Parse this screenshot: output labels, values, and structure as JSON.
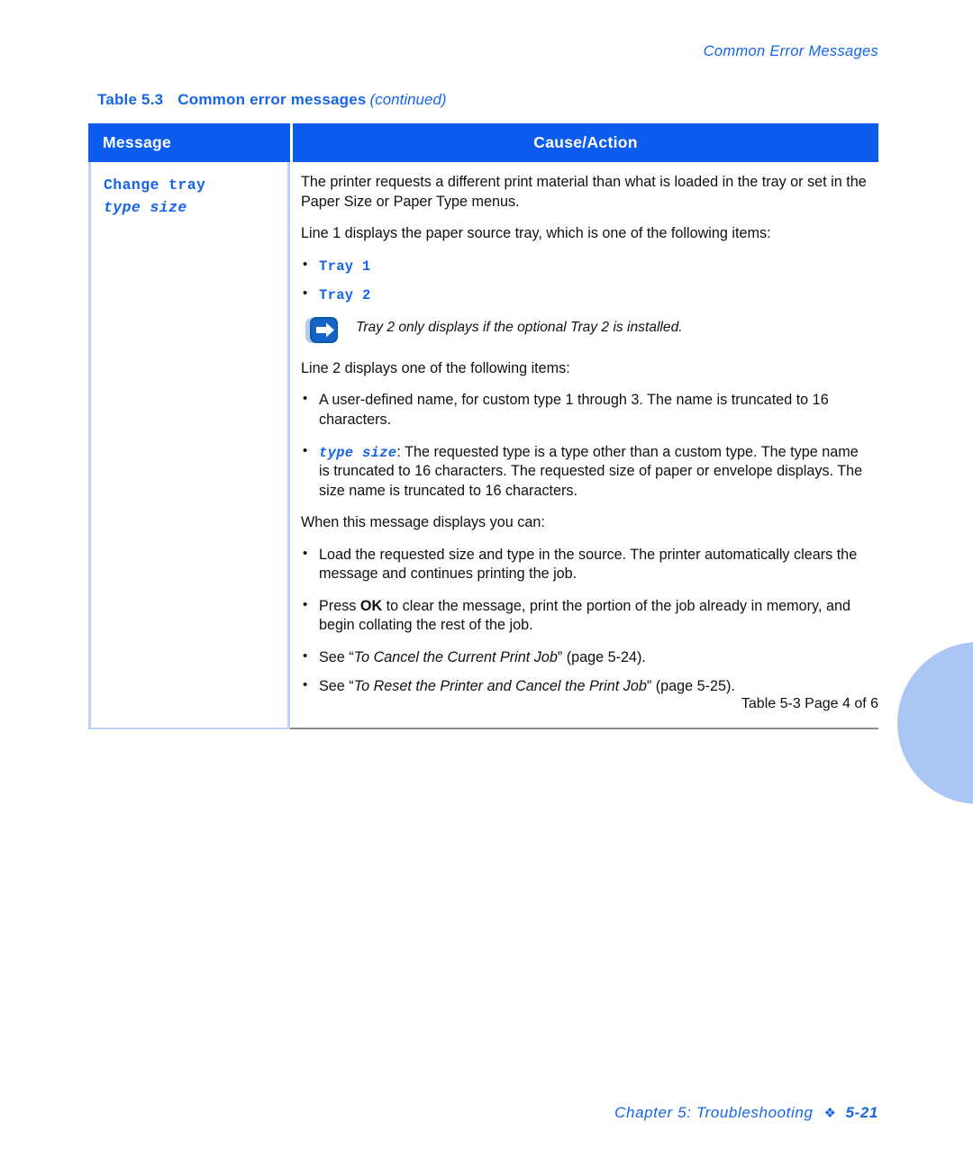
{
  "running_head": "Common Error Messages",
  "caption": {
    "number": "Table 5.3",
    "title": "Common error messages",
    "continued": "(continued)"
  },
  "colors": {
    "header_blue": "#0B5CEF",
    "text_blue": "#1565E8",
    "border_light_blue": "#BAD3F5",
    "border_gray": "#8C8C8C",
    "circle_blue": "#AAC6F2"
  },
  "table": {
    "headers": {
      "message": "Message",
      "cause_action": "Cause/Action"
    },
    "row": {
      "message_line1": "Change tray",
      "message_line2": "type size",
      "cause_action": {
        "para1": "The printer requests a different print material than what is loaded in the tray or set in the Paper Size or Paper Type menus.",
        "para2": "Line 1 displays the paper source tray, which is one of the following items:",
        "tray_items": [
          "Tray 1",
          "Tray 2"
        ],
        "note": "Tray 2 only displays if the optional Tray 2 is installed.",
        "note_icon": "arrow-right-note-icon",
        "para3": "Line 2 displays one of the following items:",
        "line2_items": [
          {
            "code": "",
            "text": "A user-defined name, for custom type 1 through 3. The name is truncated to 16 characters."
          },
          {
            "code": "type size",
            "text": ": The requested type is a type other than a custom type. The type name is truncated to 16 characters. The requested size of paper or envelope displays. The size name is truncated to 16 characters."
          }
        ],
        "para4": "When this message displays you can:",
        "action_items": [
          {
            "prefix": "Load the requested size and type in the source. The printer automatically clears the message and continues printing the job.",
            "bold": "",
            "suffix": ""
          },
          {
            "prefix": "Press ",
            "bold": "OK",
            "suffix": " to clear the message, print the portion of the job already in memory, and begin collating the rest of the job."
          }
        ],
        "see_items": [
          {
            "lead": "See “",
            "title": "To Cancel the Current Print Job",
            "tail": "” (page 5-24)."
          },
          {
            "lead": "See “",
            "title": "To Reset the Printer and Cancel the Print Job",
            "tail": "” (page 5-25)."
          }
        ]
      }
    },
    "footer_caption": "Table 5-3  Page 4 of 6"
  },
  "page_footer": {
    "chapter": "Chapter 5: Troubleshooting",
    "diamond": "❖",
    "page": "5-21"
  }
}
